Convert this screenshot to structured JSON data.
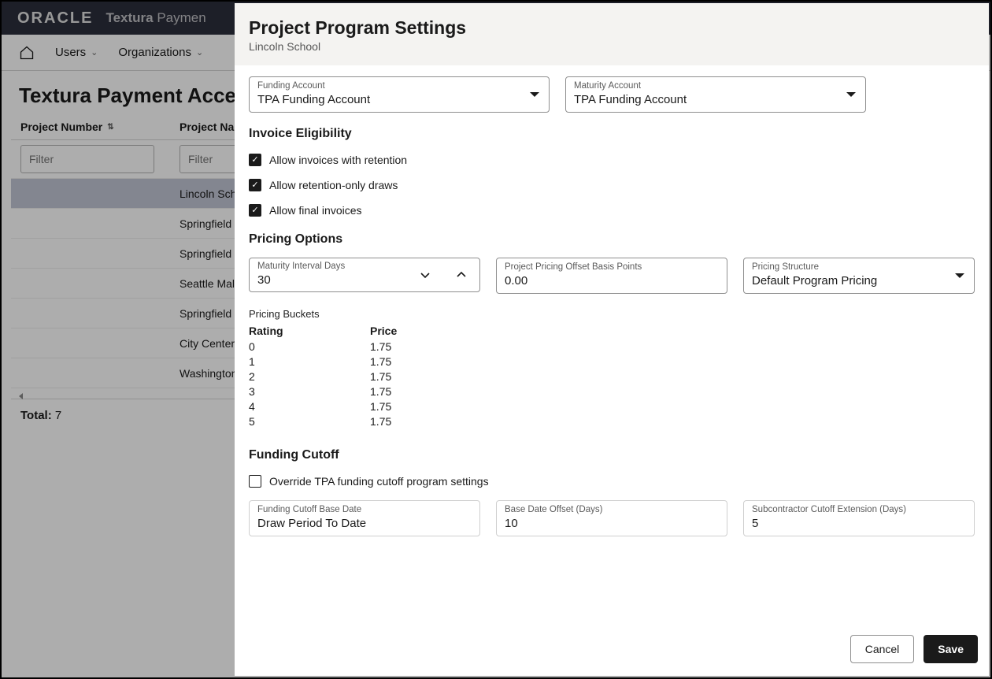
{
  "topbar": {
    "oracle": "ORACLE",
    "product_bold": "Textura",
    "product_light": " Paymen"
  },
  "nav": {
    "users": "Users",
    "orgs": "Organizations"
  },
  "page": {
    "title": "Textura Payment Accel"
  },
  "table": {
    "col1": "Project Number",
    "col2": "Project Nam",
    "filter_placeholder": "Filter",
    "rows": [
      {
        "num": "",
        "name": "Lincoln Sch"
      },
      {
        "num": "",
        "name": "Springfield"
      },
      {
        "num": "",
        "name": "Springfield"
      },
      {
        "num": "",
        "name": "Seattle Mal"
      },
      {
        "num": "",
        "name": "Springfield"
      },
      {
        "num": "",
        "name": "City Center"
      },
      {
        "num": "",
        "name": "Washington"
      }
    ],
    "total_label": "Total:",
    "total_value": "7"
  },
  "drawer": {
    "title": "Project Program Settings",
    "subtitle": "Lincoln School",
    "funding_account_label": "Funding Account",
    "funding_account_value": "TPA Funding Account",
    "maturity_account_label": "Maturity Account",
    "maturity_account_value": "TPA Funding Account",
    "invoice_h": "Invoice Eligibility",
    "cb_retention": "Allow invoices with retention",
    "cb_retention_only": "Allow retention-only draws",
    "cb_final": "Allow final invoices",
    "pricing_h": "Pricing Options",
    "maturity_interval_label": "Maturity Interval Days",
    "maturity_interval_value": "30",
    "offset_label": "Project Pricing Offset Basis Points",
    "offset_value": "0.00",
    "structure_label": "Pricing Structure",
    "structure_value": "Default Program Pricing",
    "pbuckets_h": "Pricing Buckets",
    "pb_col1": "Rating",
    "pb_col2": "Price",
    "pb_rows": [
      {
        "rating": "0",
        "price": "1.75"
      },
      {
        "rating": "1",
        "price": "1.75"
      },
      {
        "rating": "2",
        "price": "1.75"
      },
      {
        "rating": "3",
        "price": "1.75"
      },
      {
        "rating": "4",
        "price": "1.75"
      },
      {
        "rating": "5",
        "price": "1.75"
      }
    ],
    "funding_cutoff_h": "Funding Cutoff",
    "cb_override": "Override TPA funding cutoff program settings",
    "fc_base_label": "Funding Cutoff Base Date",
    "fc_base_value": "Draw Period To Date",
    "fc_offset_label": "Base Date Offset (Days)",
    "fc_offset_value": "10",
    "fc_ext_label": "Subcontractor Cutoff Extension (Days)",
    "fc_ext_value": "5",
    "cancel": "Cancel",
    "save": "Save"
  }
}
